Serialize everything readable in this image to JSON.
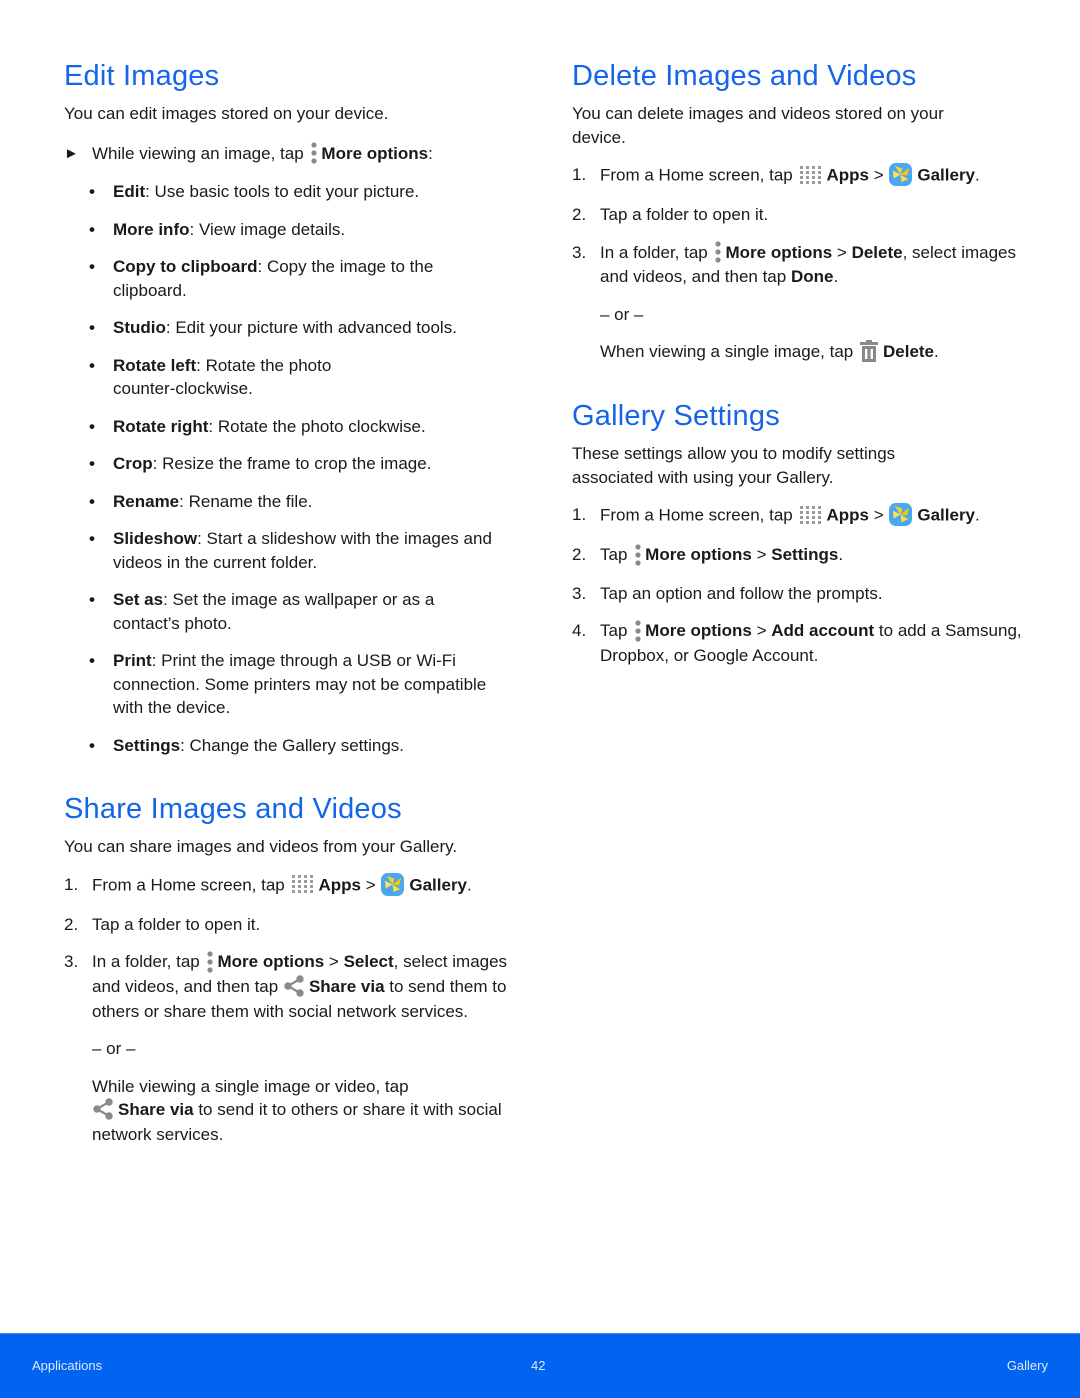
{
  "edit": {
    "title": "Edit Images",
    "intro": "You can edit images stored on your device.",
    "arrow_text": "While viewing an image, tap",
    "arrow_icon": "more-options-icon",
    "arrow_bold": "More options",
    "arrow_tail": ":",
    "items": [
      {
        "term": "Edit",
        "desc": ": Use basic tools to edit your picture."
      },
      {
        "term": "More info",
        "desc": ": View image details."
      },
      {
        "term": "Copy to clipboard",
        "desc": ": Copy the image to the clipboard."
      },
      {
        "term": "Studio",
        "desc": ": Edit your picture with advanced tools."
      },
      {
        "term": "Rotate left",
        "desc": ": Rotate the photo counter-clockwise."
      },
      {
        "term": "Rotate right",
        "desc": ": Rotate the photo clockwise."
      },
      {
        "term": "Crop",
        "desc": ": Resize the frame to crop the image."
      },
      {
        "term": "Rename",
        "desc": ": Rename the file."
      },
      {
        "term": "Slideshow",
        "desc": ": Start a slideshow with the images and videos in the current folder."
      },
      {
        "term": "Set as",
        "desc": ": Set the image as wallpaper or as a contact’s photo."
      },
      {
        "term": "Print",
        "desc": ": Print the image through a USB or Wi-Fi connection. Some printers may not be compatible with the device."
      },
      {
        "term": "Settings",
        "desc": ": Change the Gallery settings."
      }
    ]
  },
  "share": {
    "title": "Share Images and Videos",
    "intro": "You can share images and videos from your Gallery.",
    "steps": {
      "s1": {
        "num": "1.",
        "a": "From a Home screen, tap",
        "apps": "Apps",
        "sep": " > ",
        "gallery": "Gallery",
        "end": "."
      },
      "s2": {
        "num": "2.",
        "text": "Tap a folder to open it."
      },
      "s3": {
        "num": "3.",
        "a": "In a folder, tap",
        "more": "More options",
        "sep": " > ",
        "select": "Select",
        "b": ", select images and videos, and then tap",
        "share": "Share via",
        "c": " to send them to others or share them with social network services."
      }
    },
    "or": "– or –",
    "alt": {
      "a": "While viewing a single image or video, tap",
      "share": "Share via",
      "b": " to send it to others or share it with social network services."
    }
  },
  "delete": {
    "title": "Delete Images and Videos",
    "intro": "You can delete images and videos stored on your device.",
    "steps": {
      "s1": {
        "num": "1.",
        "a": "From a Home screen, tap",
        "apps": "Apps",
        "sep": " > ",
        "gallery": "Gallery",
        "end": "."
      },
      "s2": {
        "num": "2.",
        "text": "Tap a folder to open it."
      },
      "s3": {
        "num": "3.",
        "a": "In a folder, tap",
        "more": "More options",
        "sep": " > ",
        "del": "Delete",
        "b": ", select images and videos, and then tap ",
        "done": "Done",
        "end": "."
      }
    },
    "or": "– or –",
    "alt": {
      "a": "When viewing a single image, tap",
      "del": "Delete",
      "end": "."
    }
  },
  "settings": {
    "title": "Gallery Settings",
    "intro": "These settings allow you to modify settings associated with using your Gallery.",
    "steps": {
      "s1": {
        "num": "1.",
        "a": "From a Home screen, tap",
        "apps": "Apps",
        "sep": " > ",
        "gallery": "Gallery",
        "end": "."
      },
      "s2": {
        "num": "2.",
        "a": "Tap",
        "more": "More options",
        "sep": " > ",
        "set": "Settings",
        "end": "."
      },
      "s3": {
        "num": "3.",
        "text": "Tap an option and follow the prompts."
      },
      "s4": {
        "num": "4.",
        "a": "Tap",
        "more": "More options",
        "sep": " > ",
        "add": "Add account",
        "b": " to add a Samsung, Dropbox, or Google Account."
      }
    }
  },
  "footer": {
    "left": "Applications",
    "page": "42",
    "right": "Gallery",
    "bg_color": "#0064f0"
  },
  "colors": {
    "heading": "#1565e8",
    "icon_gray": "#8a8a8a"
  }
}
